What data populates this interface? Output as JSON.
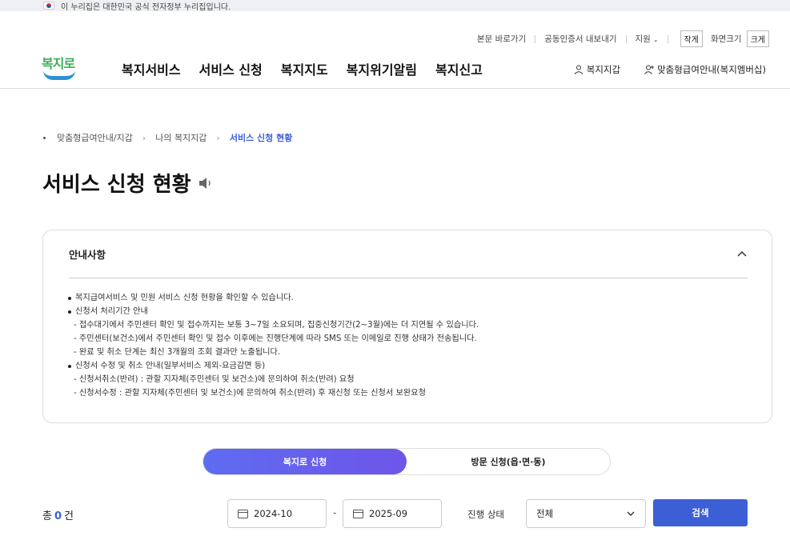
{
  "gov_banner": {
    "text": "이 누리집은 대한민국 공식 전자정부 누리집입니다."
  },
  "util": {
    "skip": "본문 바로가기",
    "cert": "공동인증서 내보내기",
    "support": "지원",
    "small": "작게",
    "screen_size": "화면크기",
    "large": "크게"
  },
  "logo": {
    "text": "복지로"
  },
  "gnb": [
    "복지서비스",
    "서비스 신청",
    "복지지도",
    "복지위기알림",
    "복지신고"
  ],
  "user_links": {
    "wallet": "복지지갑",
    "guide": "맞춤형급여안내(복지멤버십)"
  },
  "breadcrumb": [
    "맞춤형급여안내/지갑",
    "나의 복지지갑",
    "서비스 신청 현황"
  ],
  "page_title": "서비스 신청 현황",
  "notice": {
    "title": "안내사항",
    "lines": [
      {
        "type": "bullet",
        "text": "복지급여서비스 및 민원 서비스 신청 현황을 확인할 수 있습니다."
      },
      {
        "type": "bullet",
        "text": "신청서 처리기간 안내"
      },
      {
        "type": "sub",
        "text": "- 접수대기에서 주민센터 확인 및 접수까지는 보통 3~7일 소요되며, 집중신청기간(2~3월)에는 더 지연될 수 있습니다."
      },
      {
        "type": "sub",
        "text": "- 주민센터(보건소)에서 주민센터 확인 및 접수 이후에는 진행단계에 따라 SMS 또는 이메일로 진행 상태가 전송됩니다."
      },
      {
        "type": "sub",
        "text": "- 완료 및 취소 단계는 최신 3개월의 조회 결과만 노출됩니다."
      },
      {
        "type": "bullet",
        "text": "신청서 수정 및 취소 안내(일부서비스 제외-요금감면 등)"
      },
      {
        "type": "sub",
        "text": "- 신청서취소(반려) : 관할 지자체(주민센터 및 보건소)에 문의하여 취소(반려) 요청"
      },
      {
        "type": "sub",
        "text": "- 신청서수정 : 관할 지자체(주민센터 및 보건소)에 문의하여 취소(반려) 후 재신청 또는 신청서 보완요청"
      }
    ]
  },
  "tabs": {
    "online": "복지로 신청",
    "visit": "방문 신청(읍·면·동)"
  },
  "filter": {
    "total_prefix": "총",
    "total_count": "0",
    "total_suffix": "건",
    "start_date": "2024-10",
    "dash": "-",
    "end_date": "2025-09",
    "status_label": "진행 상태",
    "status_value": "전체",
    "search": "검색"
  },
  "colors": {
    "accent": "#3c5fd6",
    "tab_active": "#6366f1",
    "logo_green": "#3dae5b",
    "logo_blue": "#2e8fd8"
  }
}
